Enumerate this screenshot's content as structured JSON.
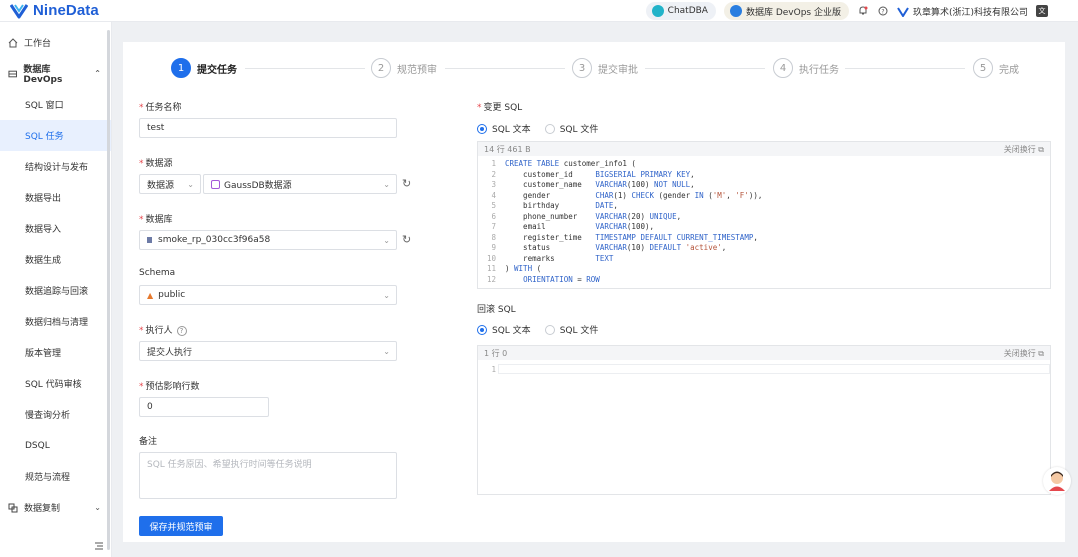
{
  "header": {
    "logo_text": "NineData",
    "chatdba_label": "ChatDBA",
    "devops_label": "数据库 DevOps 企业版",
    "company_name": "玖章算术(浙江)科技有限公司"
  },
  "sidebar": {
    "workbench": "工作台",
    "devops_group": "数据库 DevOps",
    "items": [
      {
        "label": "SQL 窗口"
      },
      {
        "label": "SQL 任务"
      },
      {
        "label": "结构设计与发布"
      },
      {
        "label": "数据导出"
      },
      {
        "label": "数据导入"
      },
      {
        "label": "数据生成"
      },
      {
        "label": "数据追踪与回滚"
      },
      {
        "label": "数据归档与清理"
      },
      {
        "label": "版本管理"
      },
      {
        "label": "SQL 代码审核"
      },
      {
        "label": "慢查询分析"
      },
      {
        "label": "DSQL"
      },
      {
        "label": "规范与流程"
      }
    ],
    "replication_group": "数据复制"
  },
  "steps": [
    {
      "num": "1",
      "label": "提交任务"
    },
    {
      "num": "2",
      "label": "规范预审"
    },
    {
      "num": "3",
      "label": "提交审批"
    },
    {
      "num": "4",
      "label": "执行任务"
    },
    {
      "num": "5",
      "label": "完成"
    }
  ],
  "form": {
    "task_name_label": "任务名称",
    "task_name_value": "test",
    "datasource_label": "数据源",
    "datasource_type": "数据源",
    "datasource_value": "GaussDB数据源",
    "database_label": "数据库",
    "database_value": "smoke_rp_030cc3f96a58",
    "schema_label": "Schema",
    "schema_value": "public",
    "executor_label": "执行人",
    "executor_value": "提交人执行",
    "affected_rows_label": "预估影响行数",
    "affected_rows_value": "0",
    "remark_label": "备注",
    "remark_placeholder": "SQL 任务原因、希望执行时间等任务说明",
    "submit_button": "保存并规范预审"
  },
  "change_sql": {
    "title": "变更 SQL",
    "option_text": "SQL 文本",
    "option_file": "SQL 文件",
    "stats": "14 行  461 B",
    "wrap_label": "关闭换行",
    "lines": [
      {
        "n": "1",
        "text": "CREATE TABLE customer_info1 ("
      },
      {
        "n": "2",
        "text": "    customer_id     BIGSERIAL PRIMARY KEY,"
      },
      {
        "n": "3",
        "text": "    customer_name   VARCHAR(100) NOT NULL,"
      },
      {
        "n": "4",
        "text": "    gender          CHAR(1) CHECK (gender IN ('M', 'F')),"
      },
      {
        "n": "5",
        "text": "    birthday        DATE,"
      },
      {
        "n": "6",
        "text": "    phone_number    VARCHAR(20) UNIQUE,"
      },
      {
        "n": "7",
        "text": "    email           VARCHAR(100),"
      },
      {
        "n": "8",
        "text": "    register_time   TIMESTAMP DEFAULT CURRENT_TIMESTAMP,"
      },
      {
        "n": "9",
        "text": "    status          VARCHAR(10) DEFAULT 'active',"
      },
      {
        "n": "10",
        "text": "    remarks         TEXT"
      },
      {
        "n": "11",
        "text": ") WITH ("
      },
      {
        "n": "12",
        "text": "    ORIENTATION = ROW"
      }
    ]
  },
  "rollback_sql": {
    "title": "回滚 SQL",
    "option_text": "SQL 文本",
    "option_file": "SQL 文件",
    "stats": "1 行  0",
    "wrap_label": "关闭换行",
    "line_number": "1"
  },
  "colors": {
    "primary": "#1f6feb",
    "required": "#e5484d",
    "logo": "#1f5fd6"
  }
}
